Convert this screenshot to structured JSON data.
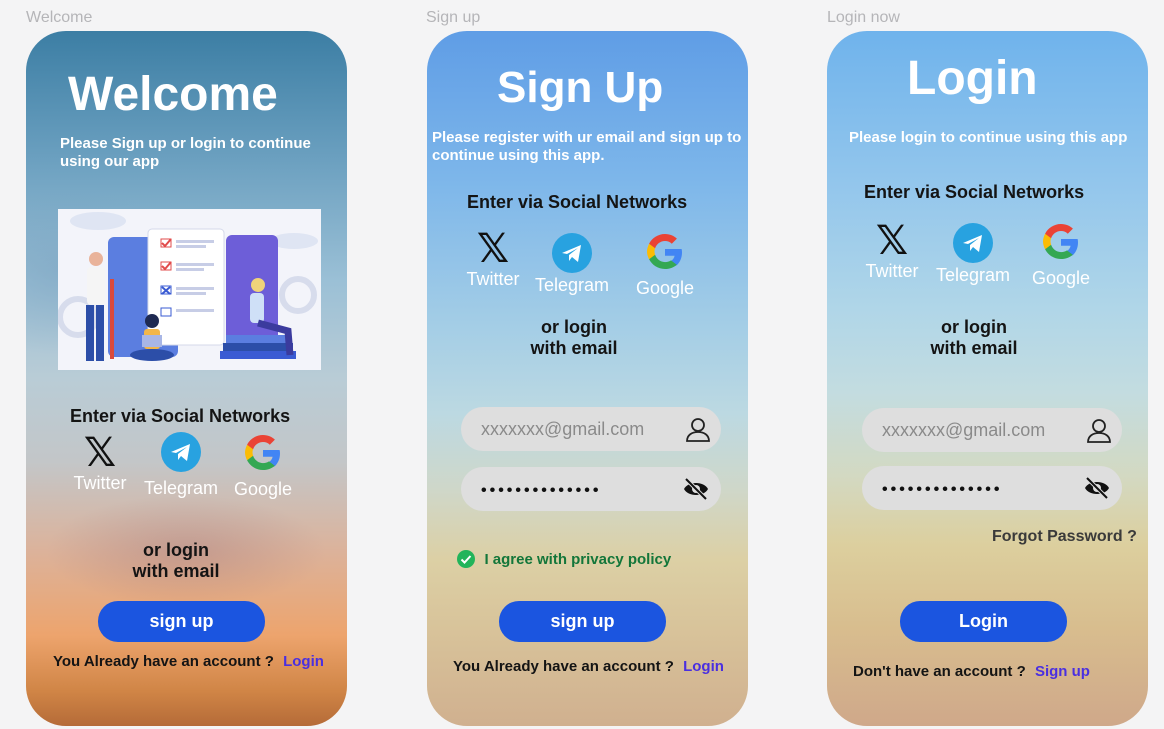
{
  "frames": {
    "welcome": {
      "label": "Welcome",
      "title": "Welcome",
      "subtitle": "Please Sign up or login to continue using our app",
      "social_heading": "Enter via Social Networks",
      "social": [
        "Twitter",
        "Telegram",
        "Google"
      ],
      "or_line1": "or login",
      "or_line2": "with email",
      "button": "sign up",
      "footer_text": "You Already have an account ?",
      "footer_link": "Login"
    },
    "signup": {
      "label": "Sign up",
      "title": "Sign Up",
      "subtitle": "Please register with ur email and sign up to continue using this app.",
      "social_heading": "Enter via Social Networks",
      "social": [
        "Twitter",
        "Telegram",
        "Google"
      ],
      "or_line1": "or login",
      "or_line2": "with email",
      "email_placeholder": "xxxxxxx@gmail.com",
      "password_mask": "••••••••••••••",
      "agree_text": "I agree with privacy policy",
      "button": "sign up",
      "footer_text": "You Already have an account ?",
      "footer_link": "Login"
    },
    "login": {
      "label": "Login now",
      "title": "Login",
      "subtitle": "Please login to continue using this app",
      "social_heading": "Enter via Social Networks",
      "social": [
        "Twitter",
        "Telegram",
        "Google"
      ],
      "or_line1": "or login",
      "or_line2": "with email",
      "email_placeholder": "xxxxxxx@gmail.com",
      "password_mask": "••••••••••••••",
      "forgot": "Forgot Password ?",
      "button": "Login",
      "footer_text": "Don't have an account ?",
      "footer_link": "Sign up"
    }
  },
  "colors": {
    "button": "#1b55e0",
    "link": "#4a2fe0",
    "agree_text": "#13763a",
    "check": "#22b45a",
    "telegram": "#28a2e0"
  },
  "icons": [
    "x-logo-icon",
    "telegram-icon",
    "google-icon",
    "user-icon",
    "eye-off-icon",
    "check-circle-icon"
  ]
}
